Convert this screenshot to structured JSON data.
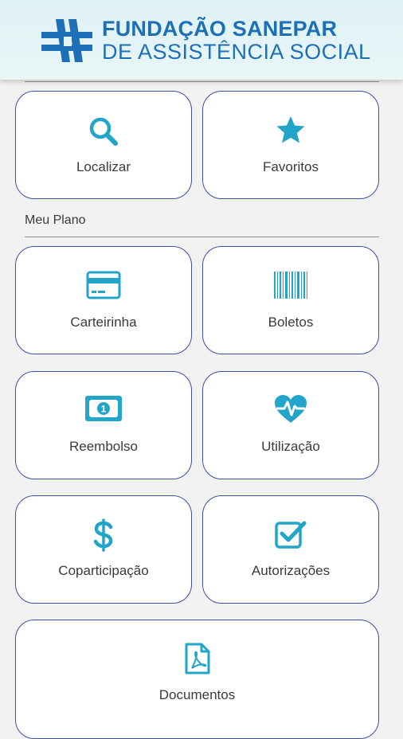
{
  "header": {
    "logo_line1": "FUNDAÇÃO SANEPAR",
    "logo_line2": "DE ASSISTÊNCIA SOCIAL",
    "logo_icon": "sanepar-cross-logo",
    "brand_color": "#1e70b6"
  },
  "quick_actions": [
    {
      "label": "Localizar",
      "icon": "search-icon"
    },
    {
      "label": "Favoritos",
      "icon": "star-icon"
    }
  ],
  "section": {
    "title": "Meu Plano"
  },
  "menu": [
    {
      "label": "Carteirinha",
      "icon": "credit-card-icon"
    },
    {
      "label": "Boletos",
      "icon": "barcode-icon"
    },
    {
      "label": "Reembolso",
      "icon": "money-bill-icon"
    },
    {
      "label": "Utilização",
      "icon": "heartbeat-icon"
    },
    {
      "label": "Coparticipação",
      "icon": "dollar-icon"
    },
    {
      "label": "Autorizações",
      "icon": "checkbox-icon"
    },
    {
      "label": "Documentos",
      "icon": "pdf-file-icon"
    }
  ],
  "colors": {
    "icon": "#22a5c9",
    "tile_border": "#3d4fa0",
    "background": "#f2f2f2"
  }
}
